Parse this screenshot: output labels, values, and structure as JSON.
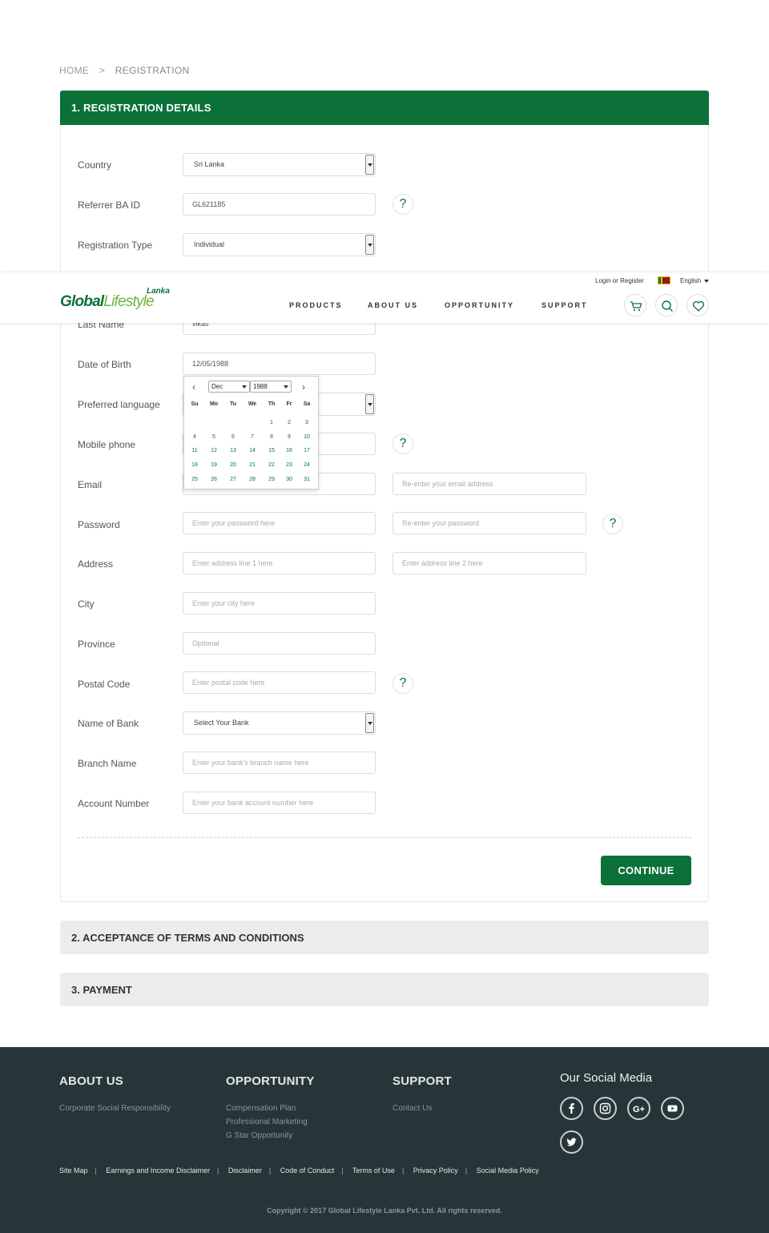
{
  "breadcrumb": {
    "home": "HOME",
    "separator": ">",
    "current": "REGISTRATION"
  },
  "section1": {
    "title": "1. REGISTRATION DETAILS"
  },
  "form": {
    "country": {
      "label": "Country",
      "value": "Sri Lanka"
    },
    "referrer": {
      "label": "Referrer BA ID",
      "value": "GL621185"
    },
    "reg_type": {
      "label": "Registration Type",
      "value": "Individual"
    },
    "last_name": {
      "label": "Last Name",
      "value": "vikas"
    },
    "dob": {
      "label": "Date of Birth",
      "value": "12/05/1988"
    },
    "pref_lang": {
      "label": "Preferred language"
    },
    "mobile": {
      "label": "Mobile phone"
    },
    "email": {
      "label": "Email",
      "confirm_placeholder": "Re-enter your email address"
    },
    "password": {
      "label": "Password",
      "placeholder": "Enter your password here",
      "confirm_placeholder": "Re-enter your password"
    },
    "address": {
      "label": "Address",
      "placeholder1": "Enter address line 1 here",
      "placeholder2": "Enter address line 2 here"
    },
    "city": {
      "label": "City",
      "placeholder": "Enter your city here"
    },
    "province": {
      "label": "Province",
      "placeholder": "Optional"
    },
    "postal": {
      "label": "Postal Code",
      "placeholder": "Enter postal code here"
    },
    "bank": {
      "label": "Name of Bank",
      "value": "Select Your Bank"
    },
    "branch": {
      "label": "Branch Name",
      "placeholder": "Enter your bank's branch name here"
    },
    "account": {
      "label": "Account Number",
      "placeholder": "Enter your bank account number here"
    },
    "help_symbol": "?"
  },
  "continue_label": "CONTINUE",
  "section2": {
    "title": "2. ACCEPTANCE OF TERMS AND CONDITIONS"
  },
  "section3": {
    "title": "3. PAYMENT"
  },
  "header": {
    "logo_top": "Lanka",
    "logo_global": "Global",
    "logo_lifestyle": "Lifestyle",
    "login": "Login or Register",
    "language": "English",
    "nav": [
      "PRODUCTS",
      "ABOUT US",
      "OPPORTUNITY",
      "SUPPORT"
    ],
    "icons": [
      "cart-icon",
      "search-icon",
      "heart-icon"
    ]
  },
  "calendar": {
    "month": "Dec",
    "year": "1988",
    "prev": "‹",
    "next": "›",
    "weekdays": [
      "Su",
      "Mo",
      "Tu",
      "We",
      "Th",
      "Fr",
      "Sa"
    ],
    "weeks": [
      [
        "",
        "",
        "",
        "",
        "1",
        "2",
        "3"
      ],
      [
        "4",
        "5",
        "6",
        "7",
        "8",
        "9",
        "10"
      ],
      [
        "11",
        "12",
        "13",
        "14",
        "15",
        "16",
        "17"
      ],
      [
        "18",
        "19",
        "20",
        "21",
        "22",
        "23",
        "24"
      ],
      [
        "25",
        "26",
        "27",
        "28",
        "29",
        "30",
        "31"
      ]
    ]
  },
  "footer": {
    "about": {
      "title": "ABOUT US",
      "links": [
        "Corporate Social Responsibility"
      ]
    },
    "opportunity": {
      "title": "OPPORTUNITY",
      "links": [
        "Compensation Plan",
        "Professional Marketing",
        "G Star Opportunity"
      ]
    },
    "support": {
      "title": "SUPPORT",
      "links": [
        "Contact Us"
      ]
    },
    "social_title": "Our Social Media",
    "social_icons": [
      "facebook-icon",
      "instagram-icon",
      "google-plus-icon",
      "youtube-icon",
      "twitter-icon"
    ],
    "bottom_links": [
      "Site Map",
      "Earnings and Income Disclaimer",
      "Disclaimer",
      "Code of Conduct",
      "Terms of Use",
      "Privacy Policy",
      "Social Media Policy"
    ],
    "copyright": "Copyright © 2017 Global Lifestyle Lanka Pvt. Ltd. All rights reserved."
  },
  "colors": {
    "brand_green": "#0b7139",
    "light_green": "#6fb43f",
    "footer_bg": "#263538",
    "section_bar": "#ececec"
  }
}
